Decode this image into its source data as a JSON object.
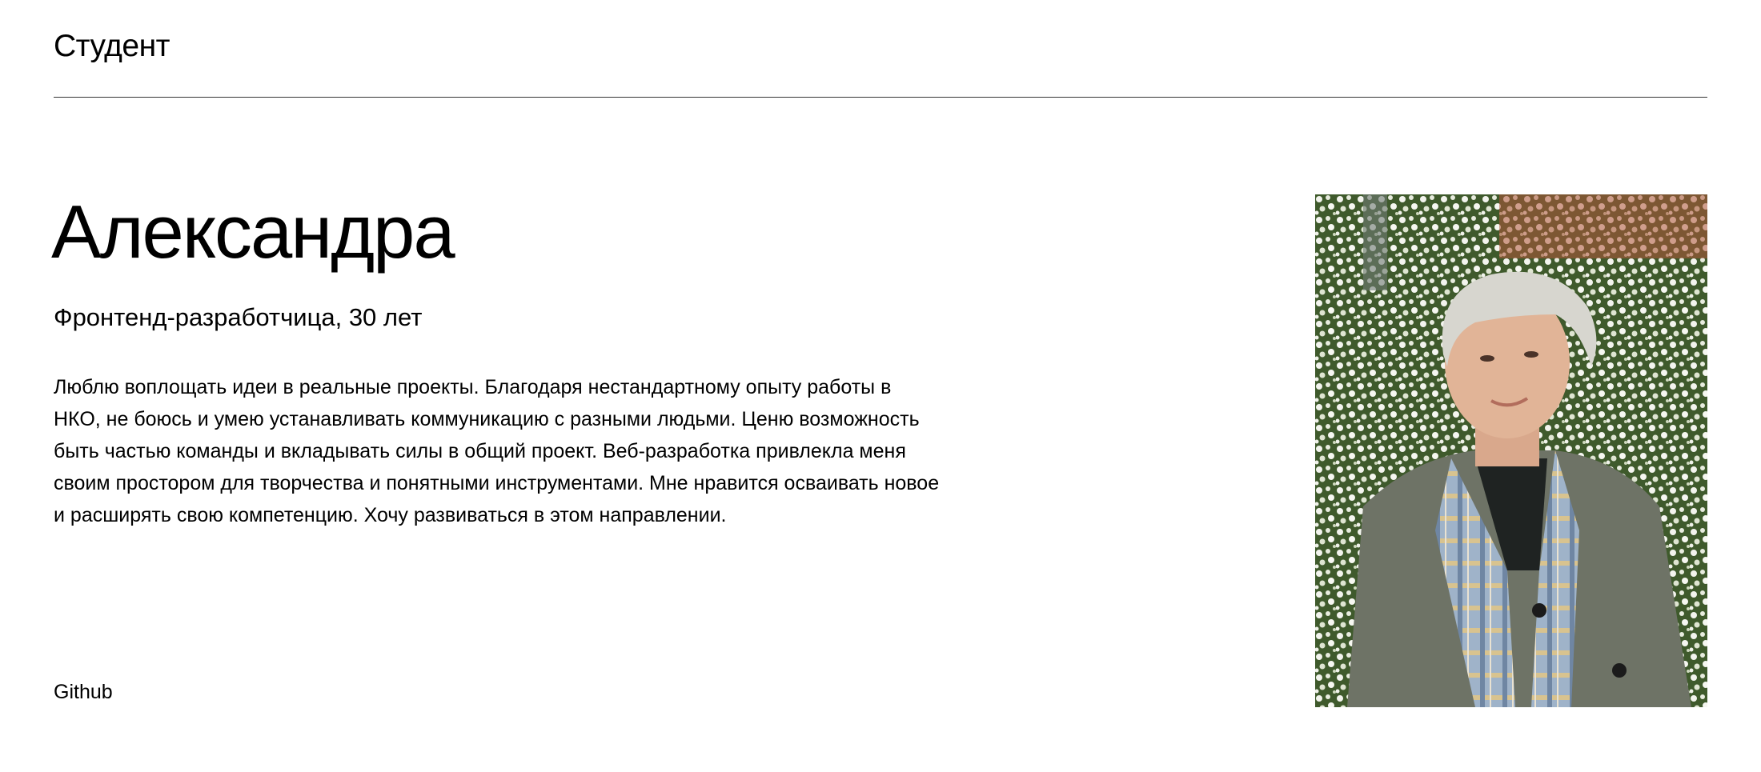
{
  "header": {
    "section_title": "Студент"
  },
  "profile": {
    "name": "Александра",
    "subtitle": "Фронтенд-разработчица, 30 лет",
    "about": "Люблю воплощать идеи в реальные проекты. Благодаря нестандартному опыту работы в НКО, не боюсь и умею устанавливать коммуникацию с разными людьми. Ценю возможность быть частью команды и вкладывать силы в общий проект. Веб-разработка привлекла меня своим простором для творчества и понятными инструментами. Мне нравится осваивать новое и расширять свою компетенцию. Хочу развиваться в этом направлении.",
    "github_label": "Github",
    "photo_icon": "student-portrait-photo"
  },
  "colors": {
    "background": "#ffffff",
    "text": "#000000",
    "divider": "#333333"
  }
}
